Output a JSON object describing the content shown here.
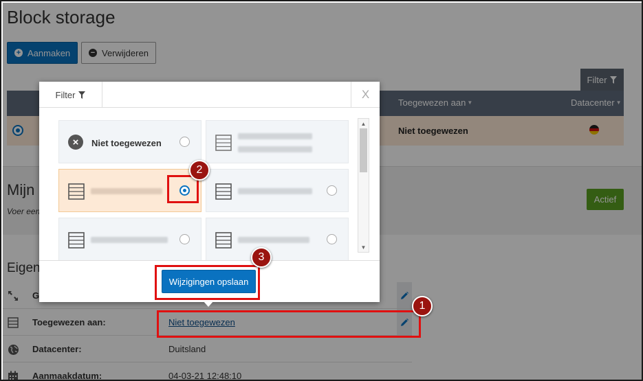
{
  "page": {
    "title": "Block storage"
  },
  "toolbar": {
    "create_label": "Aanmaken",
    "delete_label": "Verwijderen",
    "filter_label": "Filter"
  },
  "table": {
    "headers": {
      "assigned_to": "Toegewezen aan",
      "datacenter": "Datacenter"
    },
    "row": {
      "assigned_to": "Niet toegewezen"
    }
  },
  "section": {
    "title": "Mijn",
    "subtitle": "Voer een",
    "status_badge": "Actief"
  },
  "properties": {
    "title": "Eigen",
    "rows": [
      {
        "label": "G",
        "value": ""
      },
      {
        "label": "Toegewezen aan:",
        "value": "Niet toegewezen"
      },
      {
        "label": "Datacenter:",
        "value": "Duitsland"
      },
      {
        "label": "Aanmaakdatum:",
        "value": "04-03-21 12:48:10"
      }
    ]
  },
  "modal": {
    "tab_label": "Filter",
    "close_label": "X",
    "options": [
      {
        "label": "Niet toegewezen",
        "selected": false
      },
      {
        "label": "",
        "selected": false
      },
      {
        "label": "",
        "selected": true
      },
      {
        "label": "",
        "selected": false
      },
      {
        "label": "",
        "selected": false
      },
      {
        "label": "",
        "selected": false
      }
    ],
    "save_label": "Wijzigingen opslaan"
  },
  "steps": [
    "1",
    "2",
    "3"
  ],
  "colors": {
    "primary": "#0a72c0",
    "table_header": "#5f6b7c",
    "selected_row": "#fde9d6",
    "status_green": "#5aa021",
    "highlight_red": "#e01010",
    "step_badge": "#9a1410"
  },
  "icons": {
    "create": "plus-circle-icon",
    "delete": "minus-circle-icon",
    "filter": "funnel-icon",
    "server": "server-icon",
    "unassigned": "x-circle-icon",
    "expand": "expand-arrows-icon",
    "globe": "globe-icon",
    "calendar": "calendar-icon",
    "edit": "pencil-icon",
    "flag": "germany-flag-icon"
  }
}
